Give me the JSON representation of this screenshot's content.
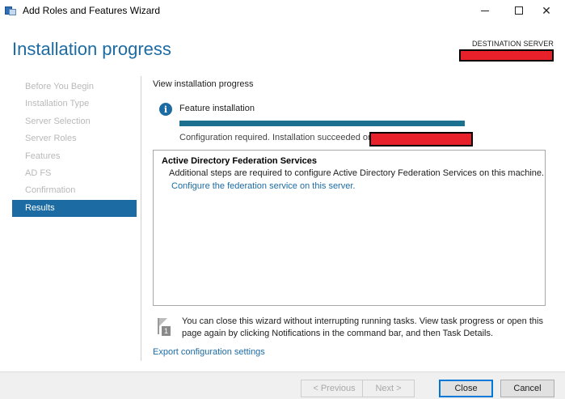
{
  "window": {
    "title": "Add Roles and Features Wizard"
  },
  "header": {
    "page_title": "Installation progress",
    "destination_label": "DESTINATION SERVER"
  },
  "sidebar": {
    "items": [
      {
        "label": "Before You Begin",
        "active": false
      },
      {
        "label": "Installation Type",
        "active": false
      },
      {
        "label": "Server Selection",
        "active": false
      },
      {
        "label": "Server Roles",
        "active": false
      },
      {
        "label": "Features",
        "active": false
      },
      {
        "label": "AD FS",
        "active": false
      },
      {
        "label": "Confirmation",
        "active": false
      },
      {
        "label": "Results",
        "active": true
      }
    ]
  },
  "main": {
    "heading": "View installation progress",
    "feature_label": "Feature installation",
    "progress_fraction": 1.0,
    "status_text": "Configuration required. Installation succeeded on",
    "result": {
      "title": "Active Directory Federation Services",
      "description": "Additional steps are required to configure Active Directory Federation Services on this machine.",
      "link": "Configure the federation service on this server."
    },
    "note": "You can close this wizard without interrupting running tasks. View task progress or open this page again by clicking Notifications in the command bar, and then Task Details.",
    "note_badge": "1",
    "export_link": "Export configuration settings"
  },
  "footer": {
    "previous": "< Previous",
    "next": "Next >",
    "close": "Close",
    "cancel": "Cancel"
  },
  "colors": {
    "accent": "#1c6ba3",
    "progress": "#1b718f",
    "redaction": "#e8202a"
  }
}
